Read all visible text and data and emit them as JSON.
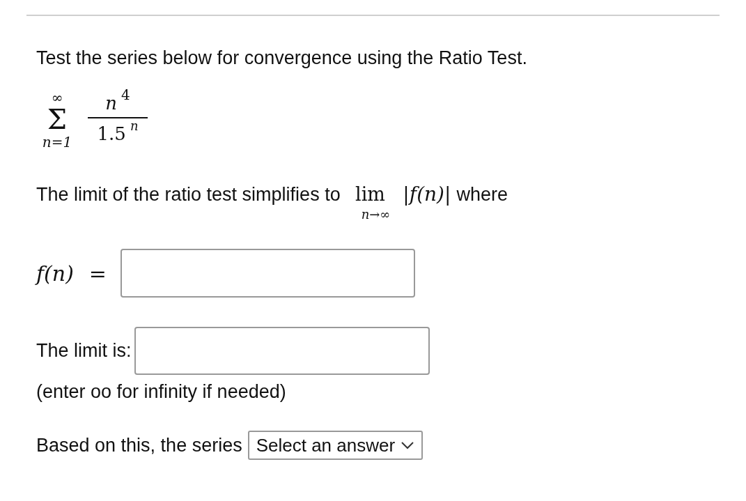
{
  "question": "Test the series below for convergence using the Ratio Test.",
  "series": {
    "sigma": "Σ",
    "upper": "∞",
    "lower": "n=1",
    "numerator": "n",
    "numerator_exponent": "4",
    "denominator": "1.5",
    "denominator_exponent": "n"
  },
  "limit_sentence": {
    "text": "The limit of the ratio test simplifies to",
    "lim": "lim",
    "lim_sub": "n→∞",
    "expr": "|f(n)|",
    "after": "where"
  },
  "fn_field": {
    "label": "f(n)",
    "equals": "="
  },
  "limit_field": {
    "label": "The limit is:"
  },
  "hint": "(enter oo for infinity if needed)",
  "conclusion": {
    "label": "Based on this, the series",
    "select": "Select an answer"
  }
}
